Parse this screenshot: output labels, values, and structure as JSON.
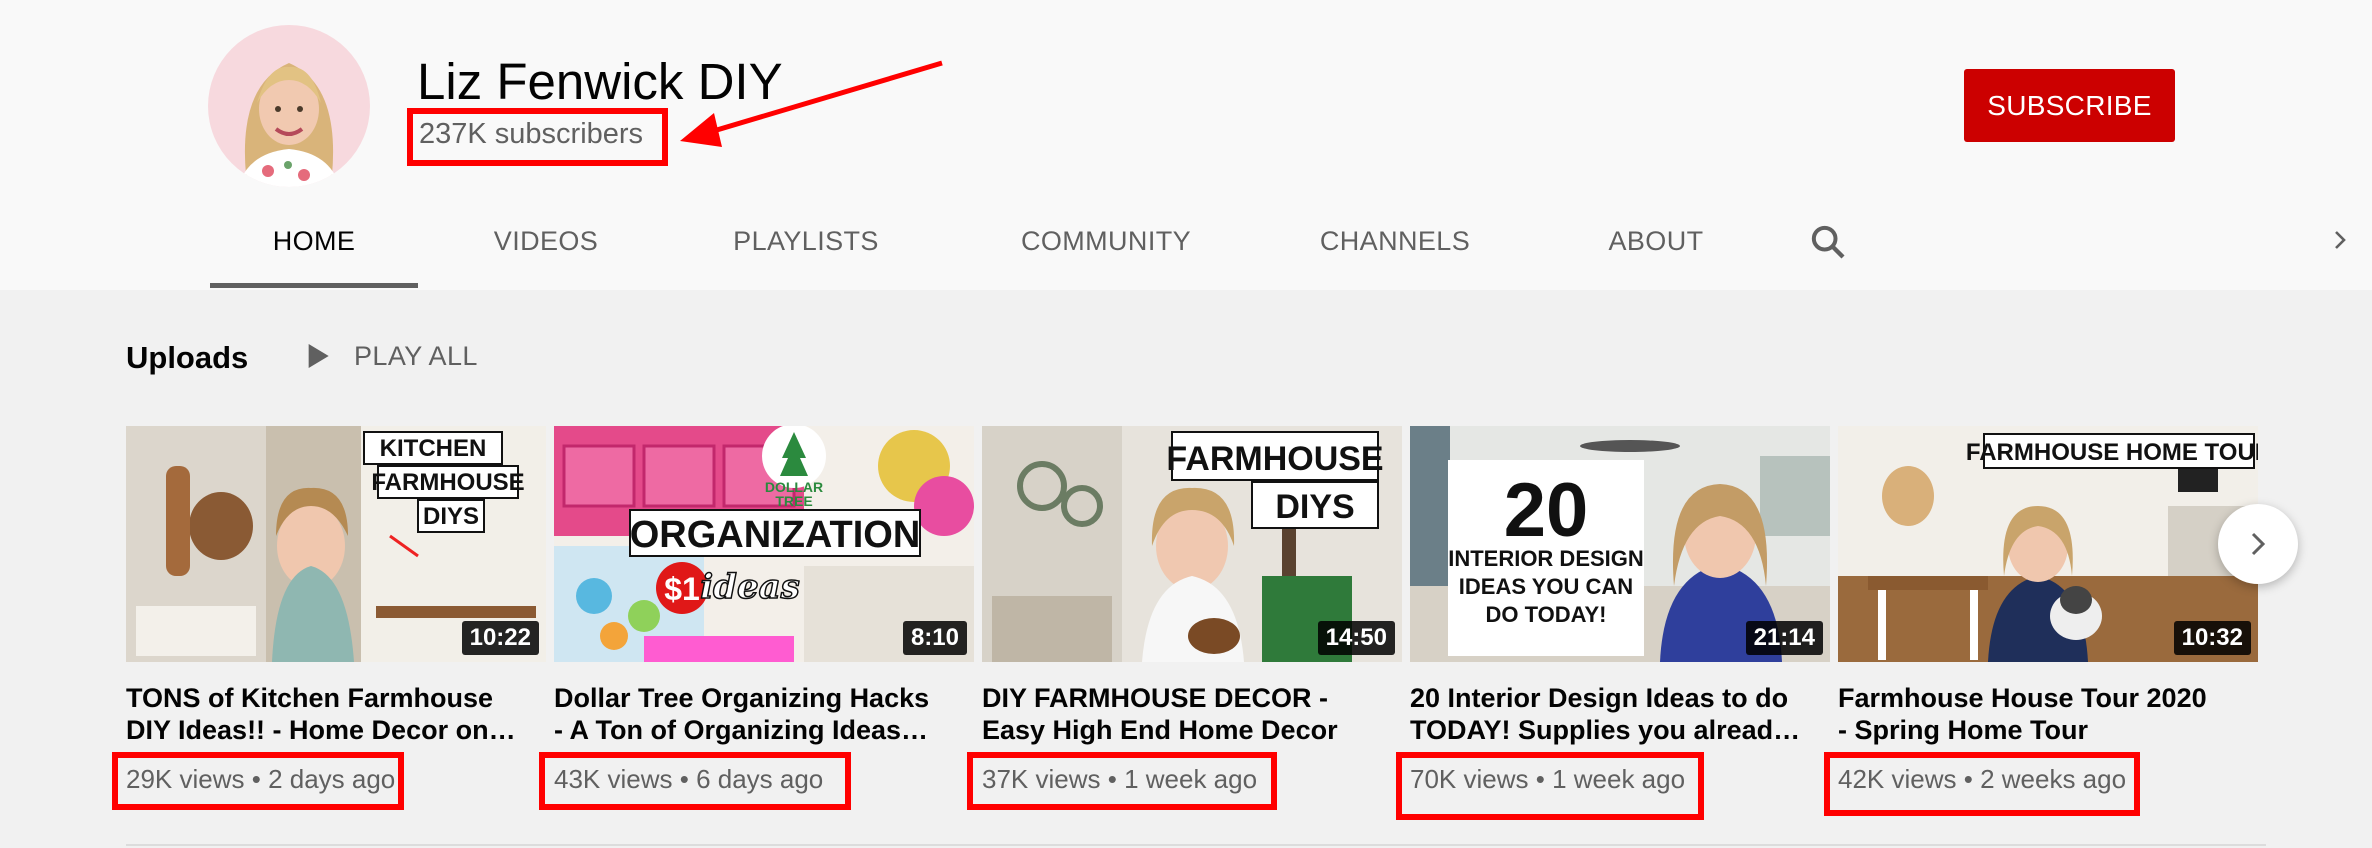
{
  "channel": {
    "name": "Liz Fenwick DIY",
    "subscribers": "237K subscribers",
    "subscribe_label": "SUBSCRIBE"
  },
  "tabs": [
    {
      "label": "HOME",
      "active": true
    },
    {
      "label": "VIDEOS"
    },
    {
      "label": "PLAYLISTS"
    },
    {
      "label": "COMMUNITY"
    },
    {
      "label": "CHANNELS"
    },
    {
      "label": "ABOUT"
    }
  ],
  "icons": {
    "search": "search-icon",
    "chevron": "chevron-right-icon",
    "play": "play-icon"
  },
  "shelf": {
    "title": "Uploads",
    "play_all": "PLAY ALL"
  },
  "videos": [
    {
      "line1": "TONS of Kitchen Farmhouse",
      "line2": "DIY Ideas!! - Home Decor on…",
      "duration": "10:22",
      "views": "29K views",
      "age": "2 days ago",
      "thumb_text": [
        "KITCHEN",
        "FARMHOUSE",
        "DIYS"
      ]
    },
    {
      "line1": "Dollar Tree Organizing Hacks",
      "line2": "- A Ton of Organizing Ideas…",
      "duration": "8:10",
      "views": "43K views",
      "age": "6 days ago",
      "thumb_text": [
        "DOLLAR",
        "TREE",
        "ORGANIZATION",
        "$1",
        "ideas"
      ]
    },
    {
      "line1": "DIY FARMHOUSE DECOR -",
      "line2": "Easy High End Home Decor",
      "duration": "14:50",
      "views": "37K views",
      "age": "1 week ago",
      "thumb_text": [
        "FARMHOUSE",
        "DIYS"
      ]
    },
    {
      "line1": "20 Interior Design Ideas to do",
      "line2": "TODAY! Supplies you alread…",
      "duration": "21:14",
      "views": "70K views",
      "age": "1 week ago",
      "thumb_text": [
        "20",
        "INTERIOR DESIGN",
        "IDEAS YOU CAN",
        "DO TODAY!"
      ]
    },
    {
      "line1": "Farmhouse House Tour 2020",
      "line2": "- Spring Home Tour",
      "duration": "10:32",
      "views": "42K views",
      "age": "2 weeks ago",
      "thumb_text": [
        "FARMHOUSE HOME TOUR"
      ]
    }
  ],
  "colors": {
    "brand": "#cc0000",
    "highlight": "#ff0000"
  }
}
